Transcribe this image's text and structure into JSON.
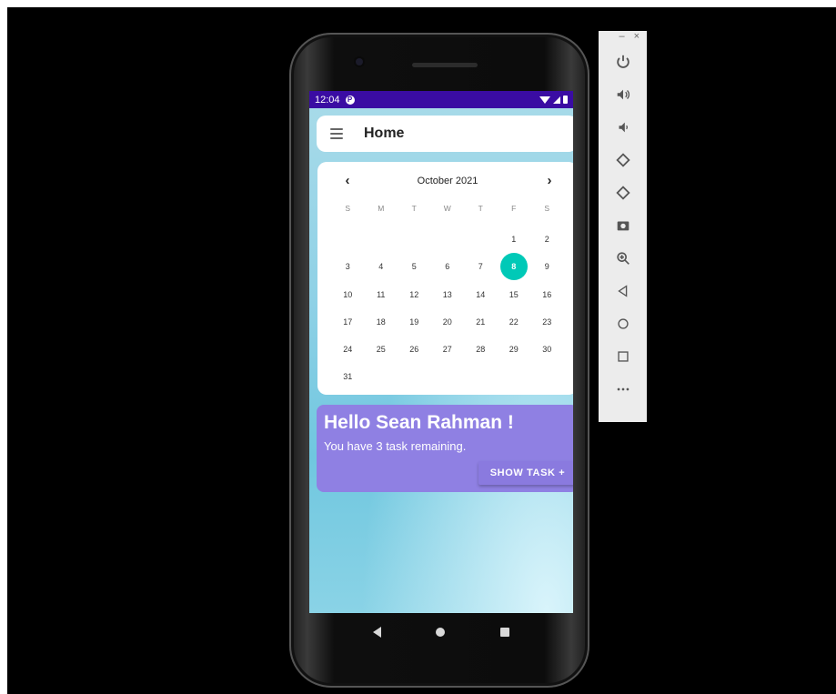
{
  "status_bar": {
    "time": "12:04",
    "notif_icon": "P"
  },
  "app_bar": {
    "title": "Home"
  },
  "calendar": {
    "month_label": "October 2021",
    "weekdays": [
      "S",
      "M",
      "T",
      "W",
      "T",
      "F",
      "S"
    ],
    "days": [
      "",
      "",
      "",
      "",
      "",
      "1",
      "2",
      "3",
      "4",
      "5",
      "6",
      "7",
      "8",
      "9",
      "10",
      "11",
      "12",
      "13",
      "14",
      "15",
      "16",
      "17",
      "18",
      "19",
      "20",
      "21",
      "22",
      "23",
      "24",
      "25",
      "26",
      "27",
      "28",
      "29",
      "30",
      "31",
      "",
      "",
      "",
      "",
      "",
      ""
    ],
    "selected_day": "8",
    "selected_color": "#00c9b7"
  },
  "greeting": {
    "title": "Hello Sean Rahman !",
    "subtitle": "You have 3 task remaining.",
    "button_label": "SHOW TASK +",
    "color": "#8f80e3"
  },
  "emulator_panel": {
    "minimize_label": "–",
    "close_label": "×",
    "buttons": [
      "power-icon",
      "volume-up-icon",
      "volume-down-icon",
      "rotate-left-icon",
      "rotate-right-icon",
      "camera-icon",
      "zoom-icon",
      "back-icon",
      "home-icon",
      "overview-icon",
      "more-icon"
    ]
  }
}
